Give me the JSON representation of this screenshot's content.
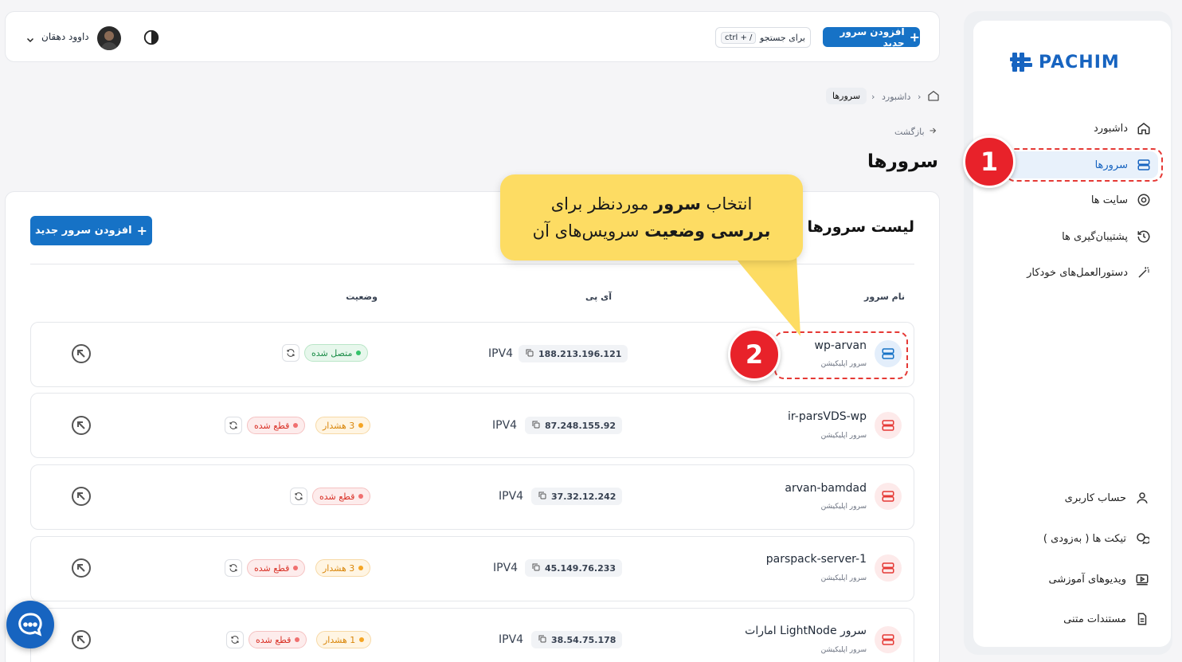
{
  "brand": {
    "logo_text": "PACHIM",
    "accent": "#1672c6"
  },
  "header": {
    "add_server_label": "افزودن سرور جدید",
    "search_label": "برای جستجو",
    "search_shortcut": "ctrl + /",
    "user_name": "داوود دهقان"
  },
  "sidebar": {
    "items": [
      {
        "label": "داشبورد",
        "icon": "home-icon"
      },
      {
        "label": "سرورها",
        "icon": "server-icon"
      },
      {
        "label": "سایت ها",
        "icon": "chrome-icon"
      },
      {
        "label": "پشتیبان‌گیری ها",
        "icon": "history-icon"
      },
      {
        "label": "دستورالعمل‌های خودکار",
        "icon": "magic-wand-icon"
      }
    ],
    "bottom_items": [
      {
        "label": "حساب کاربری",
        "icon": "user-icon"
      },
      {
        "label": "تیکت ها ( به‌زودی )",
        "icon": "chat-icon"
      },
      {
        "label": "ویدیوهای آموزشی",
        "icon": "video-icon"
      },
      {
        "label": "مستندات متنی",
        "icon": "document-icon"
      }
    ]
  },
  "breadcrumb": {
    "home": "داشبورد",
    "current": "سرورها"
  },
  "back_label": "بازگشت",
  "page_title": "سرورها",
  "list": {
    "title": "لیست سرورها",
    "add_button": "افزودن سرور جدید",
    "columns": {
      "name": "نام سرور",
      "ip": "آی پی",
      "status": "وضعیت"
    },
    "rows": [
      {
        "name": "wp-arvan",
        "sub": "سرور اپلیکیشن",
        "ip": "188.213.196.121",
        "ipv": "IPV4",
        "statuses": [
          {
            "type": "green",
            "label": "متصل شده"
          }
        ]
      },
      {
        "name": "ir-parsVDS-wp",
        "sub": "سرور اپلیکیشن",
        "ip": "87.248.155.92",
        "ipv": "IPV4",
        "statuses": [
          {
            "type": "orange",
            "label": "3 هشدار"
          },
          {
            "type": "red",
            "label": "قطع شده"
          }
        ]
      },
      {
        "name": "arvan-bamdad",
        "sub": "سرور اپلیکیشن",
        "ip": "37.32.12.242",
        "ipv": "IPV4",
        "statuses": [
          {
            "type": "red",
            "label": "قطع شده"
          }
        ]
      },
      {
        "name": "parspack-server-1",
        "sub": "سرور اپلیکیشن",
        "ip": "45.149.76.233",
        "ipv": "IPV4",
        "statuses": [
          {
            "type": "orange",
            "label": "3 هشدار"
          },
          {
            "type": "red",
            "label": "قطع شده"
          }
        ]
      },
      {
        "name": "سرور LightNode امارات",
        "sub": "سرور اپلیکیشن",
        "ip": "38.54.75.178",
        "ipv": "IPV4",
        "statuses": [
          {
            "type": "orange",
            "label": "1 هشدار"
          },
          {
            "type": "red",
            "label": "قطع شده"
          }
        ]
      }
    ]
  },
  "callout": {
    "line1_a": "انتخاب ",
    "line1_b": "سرور",
    "line1_c": " موردنظر برای",
    "line2_a": "بررسی وضعیت",
    "line2_b": " سرویس‌های آن"
  },
  "markers": {
    "one": "1",
    "two": "2"
  }
}
